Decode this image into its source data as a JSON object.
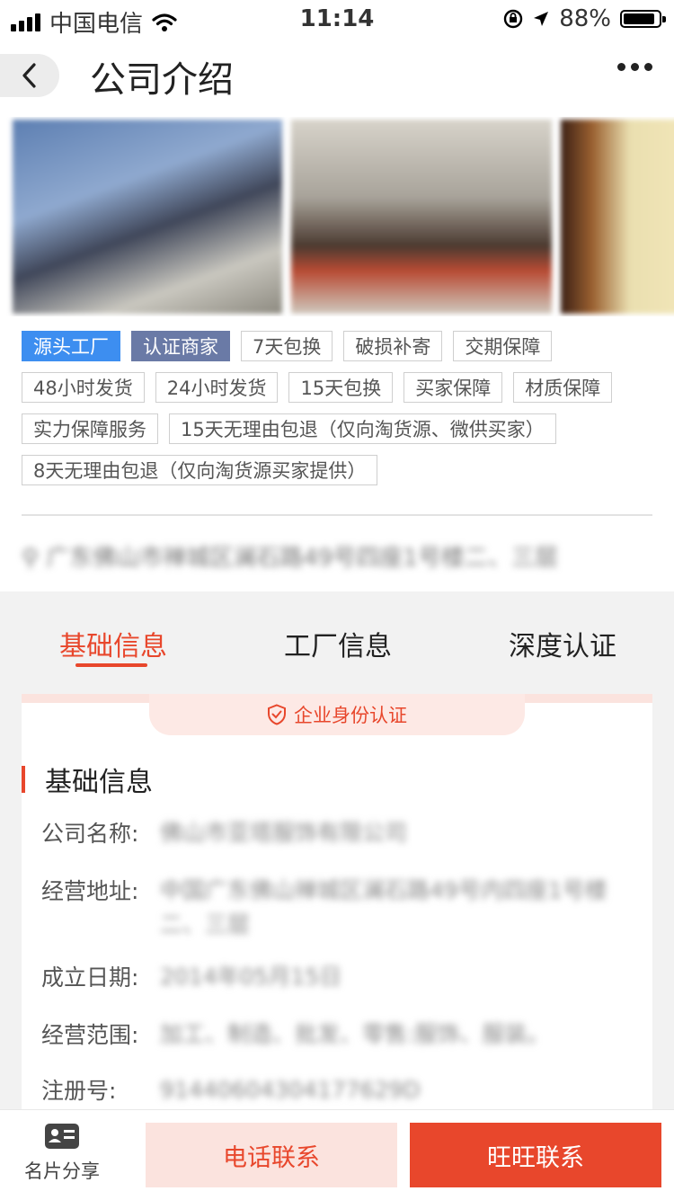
{
  "status_bar": {
    "carrier": "中国电信",
    "time": "11:14",
    "battery": "88%"
  },
  "nav": {
    "title": "公司介绍"
  },
  "tags": [
    {
      "label": "源头工厂",
      "style": "blue"
    },
    {
      "label": "认证商家",
      "style": "gray"
    },
    {
      "label": "7天包换",
      "style": "outline"
    },
    {
      "label": "破损补寄",
      "style": "outline"
    },
    {
      "label": "交期保障",
      "style": "outline"
    },
    {
      "label": "48小时发货",
      "style": "outline"
    },
    {
      "label": "24小时发货",
      "style": "outline"
    },
    {
      "label": "15天包换",
      "style": "outline"
    },
    {
      "label": "买家保障",
      "style": "outline"
    },
    {
      "label": "材质保障",
      "style": "outline"
    },
    {
      "label": "实力保障服务",
      "style": "outline"
    },
    {
      "label": "15天无理由包退（仅向淘货源、微供买家）",
      "style": "outline"
    },
    {
      "label": "8天无理由包退（仅向淘货源买家提供）",
      "style": "outline"
    }
  ],
  "address": "广东佛山市禅城区澜石路49号四座1号楼二、三层",
  "tabs": [
    {
      "label": "基础信息",
      "active": true
    },
    {
      "label": "工厂信息",
      "active": false
    },
    {
      "label": "深度认证",
      "active": false
    }
  ],
  "card": {
    "banner": "企业身份认证",
    "section_title": "基础信息",
    "rows": [
      {
        "label": "公司名称:",
        "value": "佛山市亚塔服饰有限公司"
      },
      {
        "label": "经营地址:",
        "value": "中国广东佛山禅城区澜石路49号内四座1号楼二、三层"
      },
      {
        "label": "成立日期:",
        "value": "2014年05月15日"
      },
      {
        "label": "经营范围:",
        "value": "加工、制造、批发、零售:服饰、服装。"
      },
      {
        "label": "注册号:",
        "value": "91440604304177629D"
      }
    ]
  },
  "bottom": {
    "share": "名片分享",
    "phone": "电话联系",
    "wangwang": "旺旺联系"
  },
  "colors": {
    "accent": "#e8472c",
    "tag_blue": "#3d8ef0",
    "tag_gray": "#6a7aa6"
  }
}
